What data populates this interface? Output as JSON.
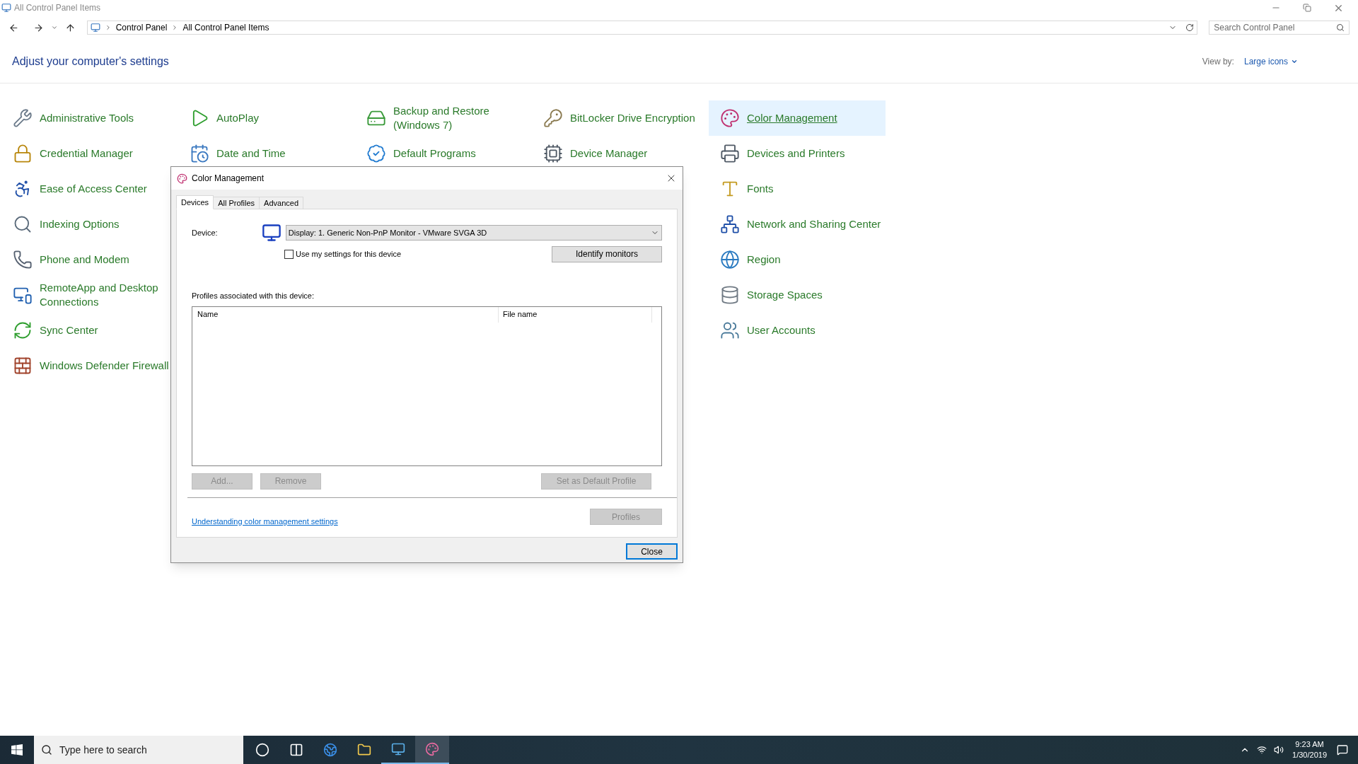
{
  "window": {
    "title": "All Control Panel Items"
  },
  "address_bar": {
    "breadcrumbs": [
      "Control Panel",
      "All Control Panel Items"
    ]
  },
  "search": {
    "placeholder": "Search Control Panel"
  },
  "heading": "Adjust your computer's settings",
  "view_by": {
    "label": "View by:",
    "value": "Large icons"
  },
  "columns": [
    {
      "items": [
        {
          "label": "Administrative Tools",
          "kind": "tools",
          "selected": false
        },
        {
          "label": "Credential Manager",
          "kind": "credential",
          "selected": false
        },
        {
          "label": "Ease of Access Center",
          "kind": "access",
          "selected": false
        },
        {
          "label": "Indexing Options",
          "kind": "indexing",
          "selected": false
        },
        {
          "label": "Phone and Modem",
          "kind": "phone",
          "selected": false
        },
        {
          "label": "RemoteApp and Desktop Connections",
          "kind": "remote",
          "selected": false
        },
        {
          "label": "Sync Center",
          "kind": "sync",
          "selected": false
        },
        {
          "label": "Windows Defender Firewall",
          "kind": "firewall",
          "selected": false
        }
      ]
    },
    {
      "items": [
        {
          "label": "AutoPlay",
          "kind": "autoplay",
          "selected": false
        },
        {
          "label": "Date and Time",
          "kind": "datetime",
          "selected": false
        }
      ]
    },
    {
      "items": [
        {
          "label": "Backup and Restore (Windows 7)",
          "kind": "backup",
          "selected": false
        },
        {
          "label": "Default Programs",
          "kind": "defaults",
          "selected": false
        }
      ]
    },
    {
      "items": [
        {
          "label": "BitLocker Drive Encryption",
          "kind": "bitlocker",
          "selected": false
        },
        {
          "label": "Device Manager",
          "kind": "devicemgr",
          "selected": false
        }
      ]
    },
    {
      "items": [
        {
          "label": "Color Management",
          "kind": "color",
          "selected": true
        },
        {
          "label": "Devices and Printers",
          "kind": "printers",
          "selected": false
        },
        {
          "label": "Fonts",
          "kind": "fonts",
          "selected": false
        },
        {
          "label": "Network and Sharing Center",
          "kind": "network",
          "selected": false
        },
        {
          "label": "Region",
          "kind": "region",
          "selected": false
        },
        {
          "label": "Storage Spaces",
          "kind": "storage",
          "selected": false
        },
        {
          "label": "User Accounts",
          "kind": "users",
          "selected": false
        }
      ]
    }
  ],
  "dialog": {
    "title": "Color Management",
    "tabs": [
      {
        "label": "Devices",
        "selected": true
      },
      {
        "label": "All Profiles",
        "selected": false
      },
      {
        "label": "Advanced",
        "selected": false
      }
    ],
    "device_label": "Device:",
    "device_value": "Display: 1. Generic Non-PnP Monitor - VMware SVGA 3D",
    "use_my_settings": {
      "label": "Use my settings for this device",
      "checked": false
    },
    "identify_button": {
      "label": "Identify monitors",
      "disabled": false
    },
    "profiles_label": "Profiles associated with this device:",
    "list_columns": [
      "Name",
      "File name"
    ],
    "list_buttons": [
      {
        "label": "Add...",
        "disabled": true
      },
      {
        "label": "Remove",
        "disabled": true
      },
      {
        "label": "Set as Default Profile",
        "disabled": true
      }
    ],
    "link": "Understanding color management settings",
    "profiles_button": {
      "label": "Profiles",
      "disabled": true
    },
    "close_button": {
      "label": "Close",
      "disabled": false
    }
  },
  "taskbar": {
    "search_placeholder": "Type here to search",
    "apps": [
      {
        "kind": "cortana",
        "running": false,
        "selected": false
      },
      {
        "kind": "taskview",
        "running": false,
        "selected": false
      },
      {
        "kind": "edge",
        "running": false,
        "selected": false
      },
      {
        "kind": "explorer",
        "running": false,
        "selected": false
      },
      {
        "kind": "controlpanel",
        "running": true,
        "selected": false
      },
      {
        "kind": "colormgmt",
        "running": true,
        "selected": true
      }
    ],
    "time": "9:23 AM",
    "date": "1/30/2019"
  }
}
